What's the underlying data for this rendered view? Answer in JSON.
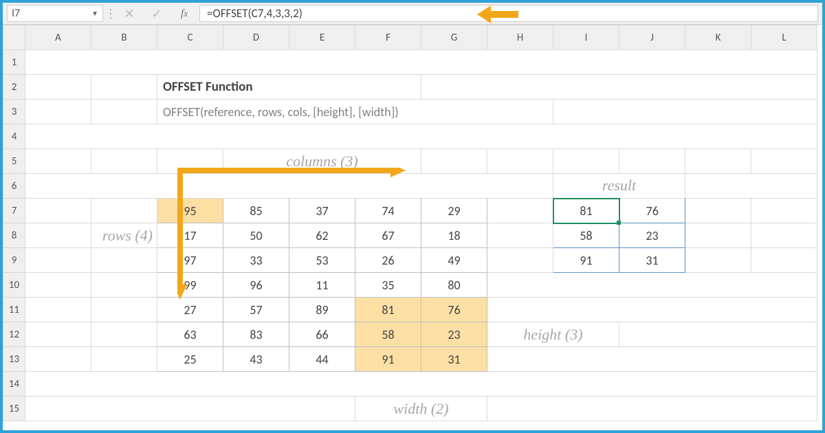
{
  "namebox": {
    "ref": "I7"
  },
  "formula_bar": {
    "text": "=OFFSET(C7,4,3,3,2)"
  },
  "title": "OFFSET Function",
  "syntax": "OFFSET(reference, rows, cols, [height], [width])",
  "labels": {
    "columns": "columns (3)",
    "rows": "rows (4)",
    "height": "height (3)",
    "width": "width (2)",
    "result": "result"
  },
  "column_headers": [
    "A",
    "B",
    "C",
    "D",
    "E",
    "F",
    "G",
    "H",
    "I",
    "J",
    "K",
    "L"
  ],
  "row_headers": [
    "1",
    "2",
    "3",
    "4",
    "5",
    "6",
    "7",
    "8",
    "9",
    "10",
    "11",
    "12",
    "13",
    "14",
    "15"
  ],
  "source_table": [
    [
      95,
      85,
      37,
      74,
      29
    ],
    [
      17,
      50,
      62,
      67,
      18
    ],
    [
      97,
      33,
      53,
      26,
      49
    ],
    [
      99,
      96,
      11,
      35,
      80
    ],
    [
      27,
      57,
      89,
      81,
      76
    ],
    [
      63,
      83,
      66,
      58,
      23
    ],
    [
      25,
      43,
      44,
      91,
      31
    ]
  ],
  "result_table": [
    [
      81,
      76
    ],
    [
      58,
      23
    ],
    [
      91,
      31
    ]
  ],
  "selected_cell": "I7",
  "colors": {
    "arrow": "#f2a71b",
    "highlight": "#fbdfa5",
    "handwriting": "#a6a6a6",
    "selection": "#1f8f5f",
    "frame": "#2ea3d9"
  }
}
